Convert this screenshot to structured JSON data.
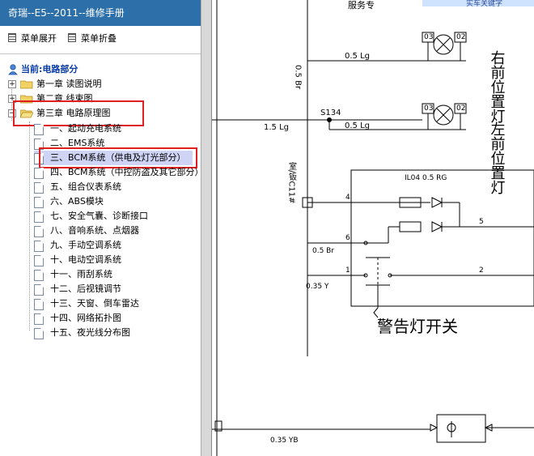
{
  "app": {
    "title": "奇瑞--E5--2011--维修手册"
  },
  "toolbar": {
    "expand_label": "菜单展开",
    "collapse_label": "菜单折叠"
  },
  "tree": {
    "root_label": "当前:电路部分",
    "chapters": [
      {
        "label": "第一章 读图说明"
      },
      {
        "label": "第二章 线束图"
      },
      {
        "label": "第三章 电路原理图"
      }
    ],
    "items": [
      {
        "label": "一、起动充电系统"
      },
      {
        "label": "二、EMS系统"
      },
      {
        "label": "三、BCM系统（供电及灯光部分）"
      },
      {
        "label": "四、BCM系统（中控防盗及其它部分）"
      },
      {
        "label": "五、组合仪表系统"
      },
      {
        "label": "六、ABS模块"
      },
      {
        "label": "七、安全气囊、诊断接口"
      },
      {
        "label": "八、音响系统、点烟器"
      },
      {
        "label": "九、手动空调系统"
      },
      {
        "label": "十、电动空调系统"
      },
      {
        "label": "十一、雨刮系统"
      },
      {
        "label": "十二、后视镜调节"
      },
      {
        "label": "十三、天窗、倒车雷达"
      },
      {
        "label": "十四、网络拓扑图"
      },
      {
        "label": "十五、夜光线分布图"
      }
    ]
  },
  "diagram": {
    "top_banner": "服务专",
    "top_right": "实车关键字",
    "labels": {
      "right_lamp": "右前位置灯",
      "left_lamp": "左前位置灯",
      "switch": "警告灯开关",
      "wire_05br": "0.5 Br",
      "wire_05lg_1": "0.5 Lg",
      "wire_05lg_2": "0.5 Lg",
      "wire_15lg": "1.5 Lg",
      "splice": "S134",
      "connector": "室/钣C11#",
      "il04": "IL04 0.5 RG",
      "pin4": "4",
      "pin6": "6",
      "pin5": "5",
      "pin1": "1",
      "pin2": "2",
      "pin03_a": "03",
      "pin02_a": "02",
      "pin03_b": "03",
      "pin02_b": "02",
      "wire_05br_b": "0.5 Br",
      "wire_035y": "0.35 Y",
      "wire_035yb": "0.35 YB"
    }
  },
  "colors": {
    "title_bar": "#2d6fa8",
    "root_text": "#0a3ca8",
    "highlight": "#e02020",
    "selected": "#cfd3f4"
  }
}
